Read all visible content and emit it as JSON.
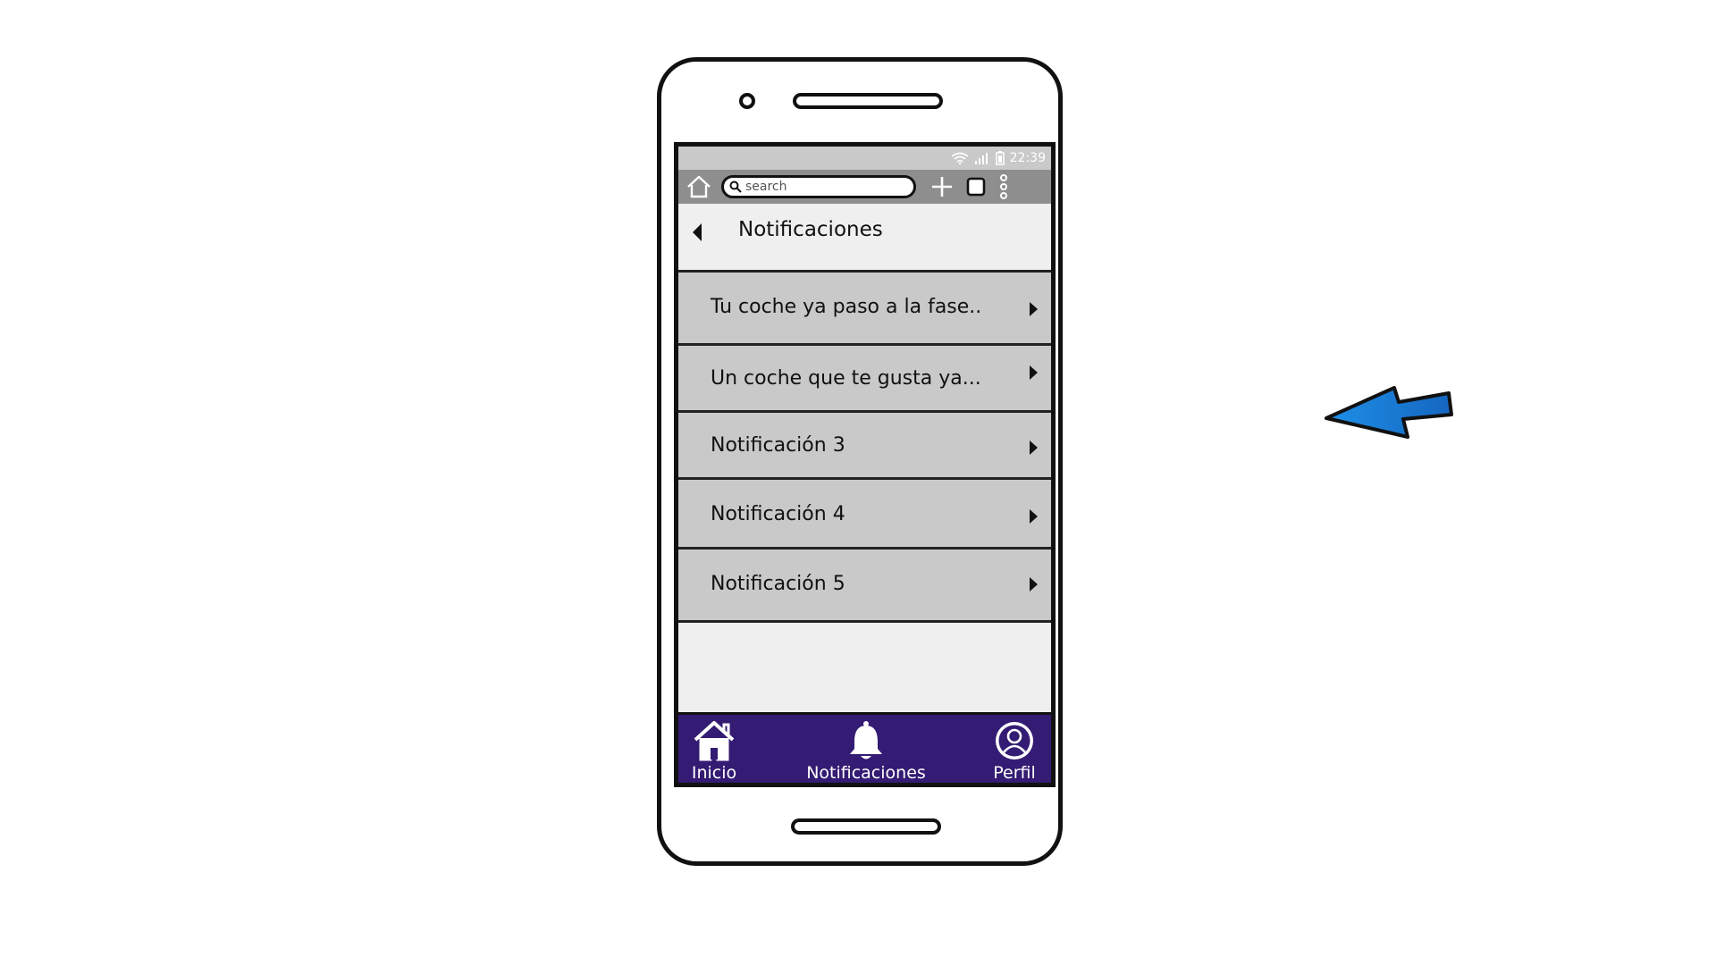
{
  "statusbar": {
    "time": "22:39",
    "icons": [
      "wifi-icon",
      "signal-icon",
      "battery-icon"
    ]
  },
  "browser": {
    "search_placeholder": "search",
    "icons": [
      "home-icon",
      "search-icon",
      "plus-icon",
      "tabs-icon",
      "more-vertical-icon"
    ]
  },
  "header": {
    "title": "Notificaciones",
    "back_icon": "back-triangle-icon"
  },
  "notifications": [
    {
      "label": "Tu coche ya paso a la fase.."
    },
    {
      "label": "Un coche que te gusta ya..."
    },
    {
      "label": "Notificación 3"
    },
    {
      "label": "Notificación 4"
    },
    {
      "label": "Notificación 5"
    }
  ],
  "bottom_nav": {
    "items": [
      {
        "label": "Inicio",
        "icon": "house-icon"
      },
      {
        "label": "Notificaciones",
        "icon": "bell-icon"
      },
      {
        "label": "Perfil",
        "icon": "user-circle-icon"
      }
    ]
  },
  "colors": {
    "nav_background": "#341b73",
    "list_item": "#c9c9c9",
    "screen_background": "#efefef",
    "arrow_fill": "#1a73d1"
  },
  "annotation": {
    "icon": "pointer-arrow-icon"
  }
}
